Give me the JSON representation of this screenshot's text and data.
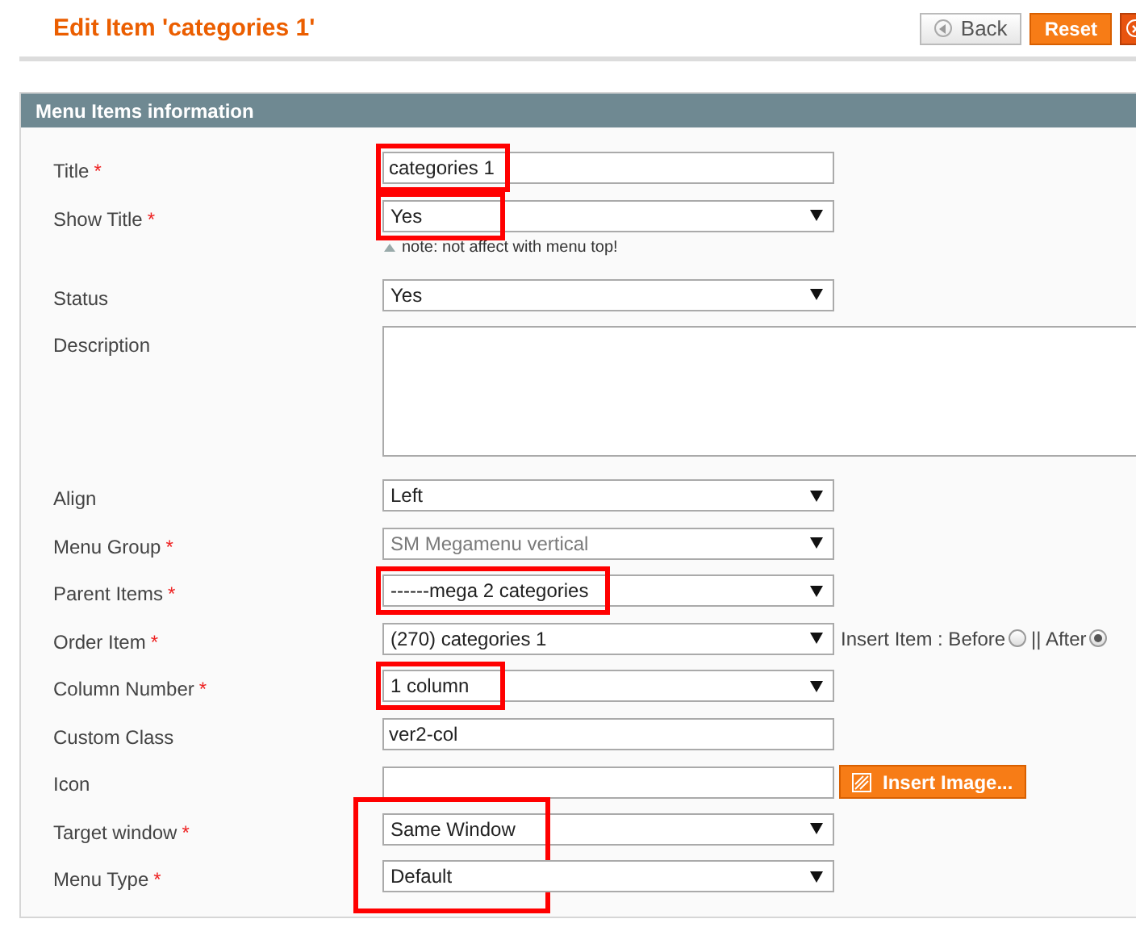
{
  "page_title": "Edit Item 'categories 1'",
  "buttons": [
    {
      "kind": "back",
      "label": "Back"
    },
    {
      "kind": "reset",
      "label": "Reset"
    },
    {
      "kind": "delete"
    }
  ],
  "panel": {
    "title": "Menu Items information"
  },
  "fields": [
    {
      "kind": "text",
      "label": "Title",
      "required_mark": "*",
      "value": "categories 1",
      "highlighted": true
    },
    {
      "kind": "select",
      "label": "Show Title",
      "required_mark": "*",
      "value": "Yes",
      "highlighted": true,
      "note": "note: not affect with menu top!"
    },
    {
      "kind": "select",
      "label": "Status",
      "value": "Yes",
      "highlighted": false
    },
    {
      "kind": "textarea",
      "label": "Description",
      "highlighted": false
    },
    {
      "kind": "select",
      "label": "Align",
      "value": "Left",
      "highlighted": false
    },
    {
      "kind": "select",
      "label": "Menu Group",
      "required_mark": "*",
      "value": "SM Megamenu vertical",
      "highlighted": false,
      "disabled": true
    },
    {
      "kind": "select",
      "label": "Parent Items",
      "required_mark": "*",
      "value": "------mega 2 categories",
      "highlighted": true
    },
    {
      "kind": "select",
      "label": "Order Item",
      "required_mark": "*",
      "value": "(270) categories 1",
      "highlighted": false,
      "extra_label": "Insert Item : Before",
      "radios": [
        {
          "selected": false
        },
        {
          "label": "|| After",
          "selected": true
        }
      ]
    },
    {
      "kind": "select",
      "label": "Column Number",
      "required_mark": "*",
      "value": "1 column",
      "highlighted": true
    },
    {
      "kind": "text",
      "label": "Custom Class",
      "value": "ver2-col",
      "highlighted": false
    },
    {
      "kind": "text",
      "label": "Icon",
      "highlighted": false,
      "button": "Insert Image..."
    },
    {
      "kind": "select",
      "label": "Target window",
      "required_mark": "*",
      "value": "Same Window",
      "highlighted": true,
      "joined_highlight": true
    },
    {
      "kind": "select",
      "label": "Menu Type",
      "required_mark": "*",
      "value": "Default",
      "highlighted": true,
      "joined_highlight": true
    }
  ]
}
